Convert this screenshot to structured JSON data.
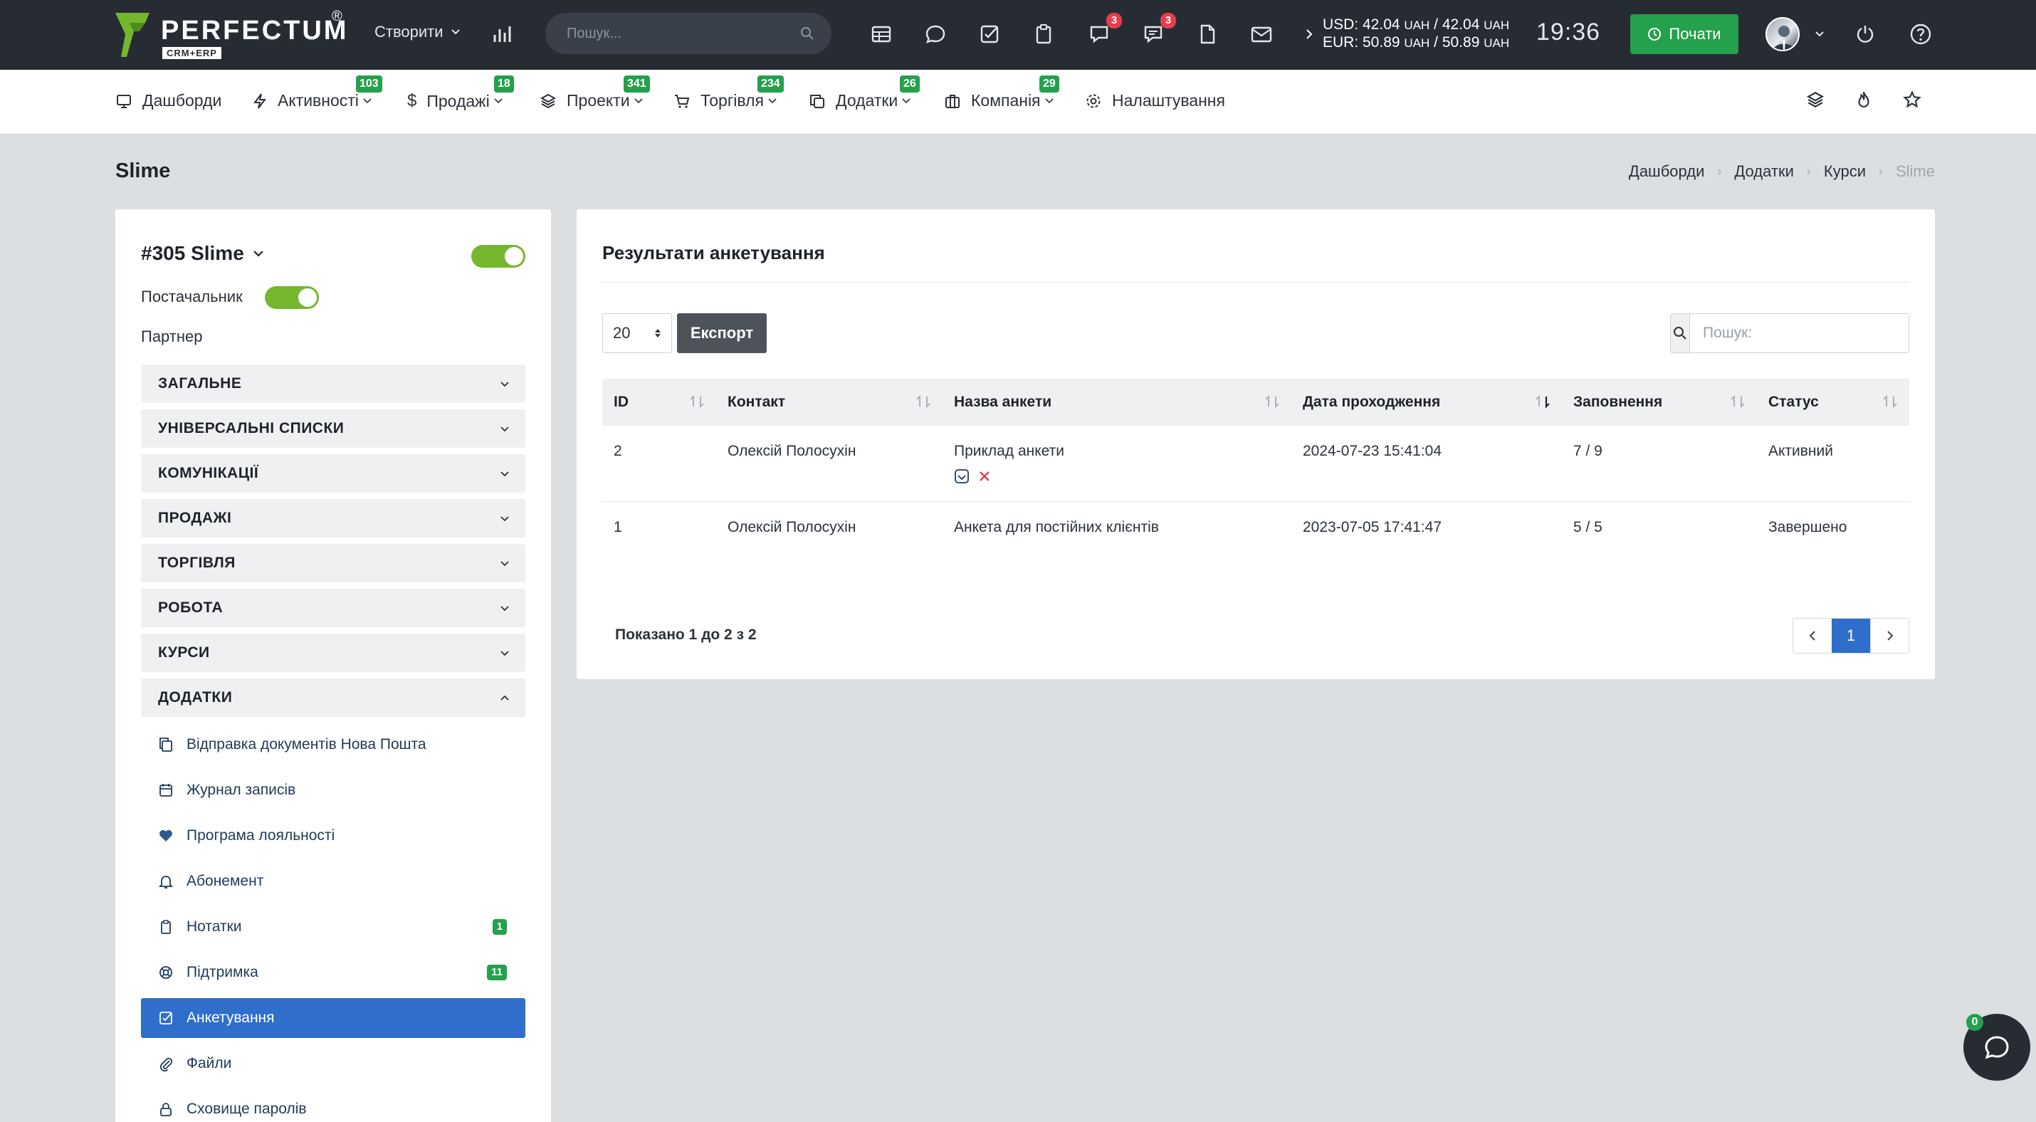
{
  "topbar": {
    "logo_text": "PERFECTUM",
    "logo_reg": "®",
    "logo_sub": "CRM+ERP",
    "create_label": "Створити",
    "search_placeholder": "Пошук...",
    "badge_messages": "3",
    "badge_chat": "3",
    "currency_usd_label": "USD: 42.04",
    "currency_usd_mid": "/ 42.04",
    "currency_eur_label": "EUR: 50.89",
    "currency_eur_mid": "/ 50.89",
    "currency_unit": "UAH",
    "clock": "19:36",
    "start_label": "Почати"
  },
  "nav": {
    "items": [
      {
        "label": "Дашборди",
        "badge": ""
      },
      {
        "label": "Активності",
        "badge": "103"
      },
      {
        "label": "Продажі",
        "badge": "18"
      },
      {
        "label": "Проекти",
        "badge": "341"
      },
      {
        "label": "Торгівля",
        "badge": "234"
      },
      {
        "label": "Додатки",
        "badge": "26"
      },
      {
        "label": "Компанія",
        "badge": "29"
      },
      {
        "label": "Налаштування",
        "badge": ""
      }
    ]
  },
  "page": {
    "title": "Slime",
    "breadcrumb": [
      "Дашборди",
      "Додатки",
      "Курси",
      "Slime"
    ]
  },
  "left": {
    "title": "#305 Slime",
    "supplier_label": "Постачальник",
    "partner_label": "Партнер",
    "sections": [
      "ЗАГАЛЬНЕ",
      "УНІВЕРСАЛЬНІ СПИСКИ",
      "КОМУНІКАЦІЇ",
      "ПРОДАЖІ",
      "ТОРГІВЛЯ",
      "РОБОТА",
      "КУРСИ",
      "ДОДАТКИ"
    ],
    "addons": [
      {
        "label": "Відправка документів Нова Пошта",
        "count": ""
      },
      {
        "label": "Журнал записів",
        "count": ""
      },
      {
        "label": "Програма лояльності",
        "count": ""
      },
      {
        "label": "Абонемент",
        "count": ""
      },
      {
        "label": "Нотатки",
        "count": "1"
      },
      {
        "label": "Підтримка",
        "count": "11"
      },
      {
        "label": "Анкетування",
        "count": ""
      },
      {
        "label": "Файли",
        "count": ""
      },
      {
        "label": "Сховище паролів",
        "count": ""
      }
    ]
  },
  "results": {
    "title": "Результати анкетування",
    "page_size": "20",
    "export_label": "Експорт",
    "search_placeholder": "Пошук:",
    "columns": [
      "ID",
      "Контакт",
      "Назва анкети",
      "Дата проходження",
      "Заповнення",
      "Статус"
    ],
    "rows": [
      {
        "id": "2",
        "contact": "Олексій Полосухін",
        "survey": "Приклад анкети",
        "date": "2024-07-23 15:41:04",
        "fill": "7 / 9",
        "status": "Активний"
      },
      {
        "id": "1",
        "contact": "Олексій Полосухін",
        "survey": "Анкета для постійних клієнтів",
        "date": "2023-07-05 17:41:47",
        "fill": "5 / 5",
        "status": "Завершено"
      }
    ],
    "info": "Показано 1 до 2 з 2",
    "current_page": "1"
  },
  "chat": {
    "badge": "0"
  },
  "colors": {
    "accent": "#2f6ecb",
    "green": "#25a04c",
    "topbar": "#272c33",
    "toggle": "#74b72e",
    "danger": "#e63e4f"
  }
}
